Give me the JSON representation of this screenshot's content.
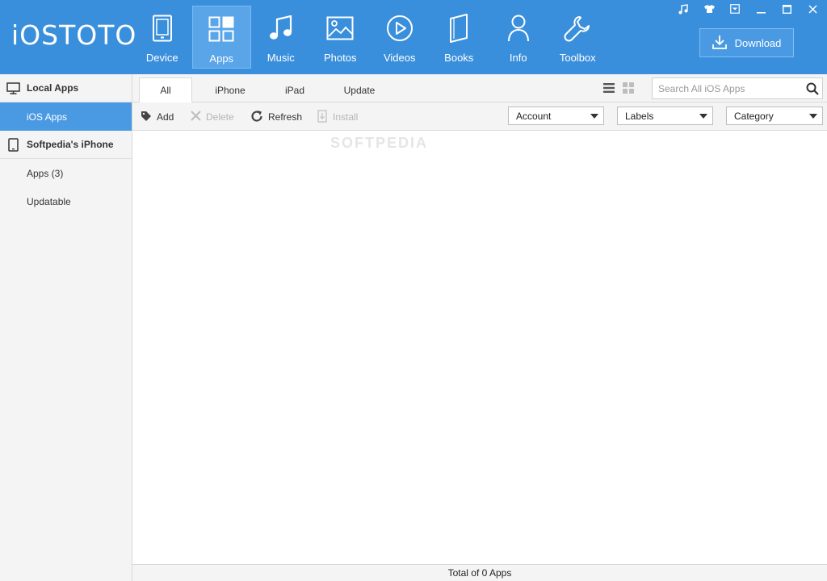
{
  "app": {
    "title": "iOSTOTO",
    "brand_color": "#3a8fdc",
    "accent_color": "#4a9ae3"
  },
  "header": {
    "nav": [
      {
        "label": "Device",
        "icon": "tablet-icon"
      },
      {
        "label": "Apps",
        "icon": "apps-grid-icon"
      },
      {
        "label": "Music",
        "icon": "music-note-icon"
      },
      {
        "label": "Photos",
        "icon": "photo-icon"
      },
      {
        "label": "Videos",
        "icon": "play-circle-icon"
      },
      {
        "label": "Books",
        "icon": "book-icon"
      },
      {
        "label": "Info",
        "icon": "user-icon"
      },
      {
        "label": "Toolbox",
        "icon": "wrench-icon"
      }
    ],
    "active_nav": "Apps",
    "download_label": "Download"
  },
  "sidebar": {
    "sections": [
      {
        "title": "Local Apps",
        "icon": "monitor-icon",
        "items": [
          {
            "label": "iOS Apps",
            "active": true
          }
        ]
      },
      {
        "title": "Softpedia's iPhone",
        "icon": "phone-icon",
        "items": [
          {
            "label": "Apps (3)"
          },
          {
            "label": "Updatable"
          }
        ]
      }
    ]
  },
  "tabs": [
    {
      "label": "All",
      "active": true
    },
    {
      "label": "iPhone"
    },
    {
      "label": "iPad"
    },
    {
      "label": "Update"
    }
  ],
  "search": {
    "placeholder": "Search All iOS Apps"
  },
  "toolbar": {
    "add_label": "Add",
    "delete_label": "Delete",
    "refresh_label": "Refresh",
    "install_label": "Install"
  },
  "filters": {
    "account": "Account",
    "labels": "Labels",
    "category": "Category"
  },
  "watermark": "SOFTPEDIA",
  "status": "Total of 0 Apps"
}
